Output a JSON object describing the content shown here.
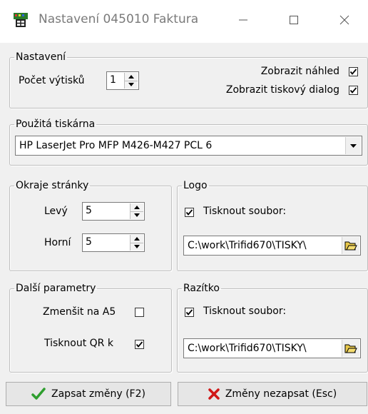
{
  "window": {
    "title": "Nastavení 045010 Faktura",
    "icons": {
      "app": "printer-app-icon",
      "minimize": "minimize-icon",
      "maximize": "maximize-icon",
      "close": "close-icon"
    }
  },
  "nastaveni": {
    "legend": "Nastavení",
    "pocet_label": "Počet výtisků",
    "pocet_value": "1",
    "nahled_label": "Zobrazit náhled",
    "nahled_checked": true,
    "dialog_label": "Zobrazit tiskový dialog",
    "dialog_checked": true
  },
  "tiskarna": {
    "legend": "Použitá tiskárna",
    "value": "HP LaserJet Pro MFP M426-M427 PCL 6"
  },
  "okraje": {
    "legend": "Okraje stránky",
    "levy_label": "Levý",
    "levy_value": "5",
    "horni_label": "Horní",
    "horni_value": "5"
  },
  "logo": {
    "legend": "Logo",
    "tisknout_label": "Tisknout soubor:",
    "tisknout_checked": true,
    "path": "C:\\work\\Trifid670\\TISKY\\"
  },
  "dalsi": {
    "legend": "Další parametry",
    "a5_label": "Zmenšit na A5",
    "a5_checked": false,
    "qr_label": "Tisknout QR k",
    "qr_checked": true
  },
  "razitko": {
    "legend": "Razítko",
    "tisknout_label": "Tisknout soubor:",
    "tisknout_checked": true,
    "path": "C:\\work\\Trifid670\\TISKY\\"
  },
  "buttons": {
    "save_label": "Zapsat změny (F2)",
    "cancel_label": "Změny nezapsat (Esc)"
  },
  "colors": {
    "save_check": "#2e9e2e",
    "cancel_x": "#d01818",
    "folder": "#d8b020"
  }
}
